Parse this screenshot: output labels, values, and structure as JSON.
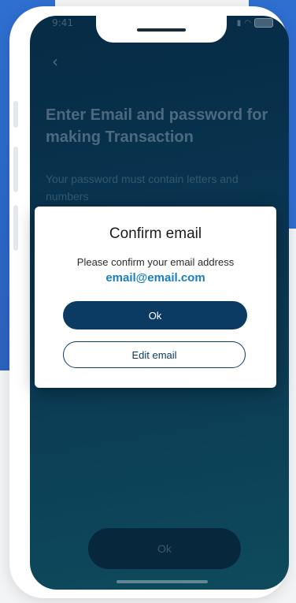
{
  "status_bar": {
    "time": "9:41",
    "signal_icon": "signal-icon",
    "wifi_icon": "wifi-icon",
    "battery_icon": "battery-icon"
  },
  "nav": {
    "back_icon": "chevron-left-icon",
    "back_glyph": "‹"
  },
  "screen": {
    "heading": "Enter Email and password for making Transaction",
    "subtext": "Your password must contain letters and numbers",
    "bottom_button_label": "Ok"
  },
  "dialog": {
    "title": "Confirm email",
    "message": "Please confirm your email address",
    "email": "email@email.com",
    "ok_label": "Ok",
    "edit_label": "Edit email"
  },
  "colors": {
    "background_accent": "#2f6fd0",
    "screen_top": "#062b45",
    "screen_bottom": "#0e4a5c",
    "primary_button": "#0b3a63",
    "email_link": "#1a7fc1"
  }
}
